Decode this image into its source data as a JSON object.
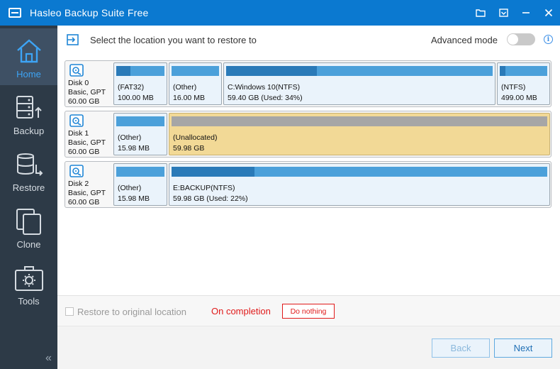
{
  "window": {
    "title": "Hasleo Backup Suite Free",
    "controls": [
      "folder-icon",
      "dropdown-menu-icon",
      "minimize-icon",
      "close-icon"
    ]
  },
  "sidebar": {
    "items": [
      {
        "label": "Home",
        "icon": "home-icon",
        "active": true
      },
      {
        "label": "Backup",
        "icon": "backup-icon",
        "active": false
      },
      {
        "label": "Restore",
        "icon": "restore-icon",
        "active": false
      },
      {
        "label": "Clone",
        "icon": "clone-icon",
        "active": false
      },
      {
        "label": "Tools",
        "icon": "tools-icon",
        "active": false
      }
    ],
    "collapse_glyph": "«"
  },
  "header": {
    "title": "Select the location you want to restore to",
    "advanced_mode_label": "Advanced mode",
    "advanced_mode_on": false,
    "info_glyph": "i"
  },
  "disks": [
    {
      "name": "Disk 0",
      "type": "Basic, GPT",
      "size": "60.00 GB",
      "partitions": [
        {
          "label": "(FAT32)",
          "size": "100.00 MB",
          "used_fraction": 0.3,
          "unallocated": false
        },
        {
          "label": "(Other)",
          "size": "16.00 MB",
          "used_fraction": 0,
          "unallocated": false
        },
        {
          "label": "C:Windows 10(NTFS)",
          "size": "59.40 GB (Used: 34%)",
          "used_fraction": 0.34,
          "unallocated": false
        },
        {
          "label": "(NTFS)",
          "size": "499.00 MB",
          "used_fraction": 0.12,
          "unallocated": false
        }
      ]
    },
    {
      "name": "Disk 1",
      "type": "Basic, GPT",
      "size": "60.00 GB",
      "partitions": [
        {
          "label": "(Other)",
          "size": "15.98 MB",
          "used_fraction": 0,
          "unallocated": false
        },
        {
          "label": "(Unallocated)",
          "size": "59.98 GB",
          "used_fraction": 0,
          "unallocated": true
        }
      ]
    },
    {
      "name": "Disk 2",
      "type": "Basic, GPT",
      "size": "60.00 GB",
      "partitions": [
        {
          "label": "(Other)",
          "size": "15.98 MB",
          "used_fraction": 0,
          "unallocated": false
        },
        {
          "label": "E:BACKUP(NTFS)",
          "size": "59.98 GB (Used: 22%)",
          "used_fraction": 0.22,
          "unallocated": false
        }
      ]
    }
  ],
  "options": {
    "restore_original_label": "Restore to original location",
    "restore_original_checked": false,
    "on_completion_label": "On completion",
    "on_completion_value": "Do nothing"
  },
  "footer": {
    "back_label": "Back",
    "next_label": "Next"
  },
  "colors": {
    "titlebar": "#0b79d0",
    "sidebar": "#2d3a47",
    "sidebar_active": "#3e5064",
    "accent": "#3da4f5",
    "partition_bar": "#4ba0da",
    "partition_used": "#2a7ab8",
    "unallocated_fill": "#f2d996",
    "warning_red": "#e01a1a"
  }
}
